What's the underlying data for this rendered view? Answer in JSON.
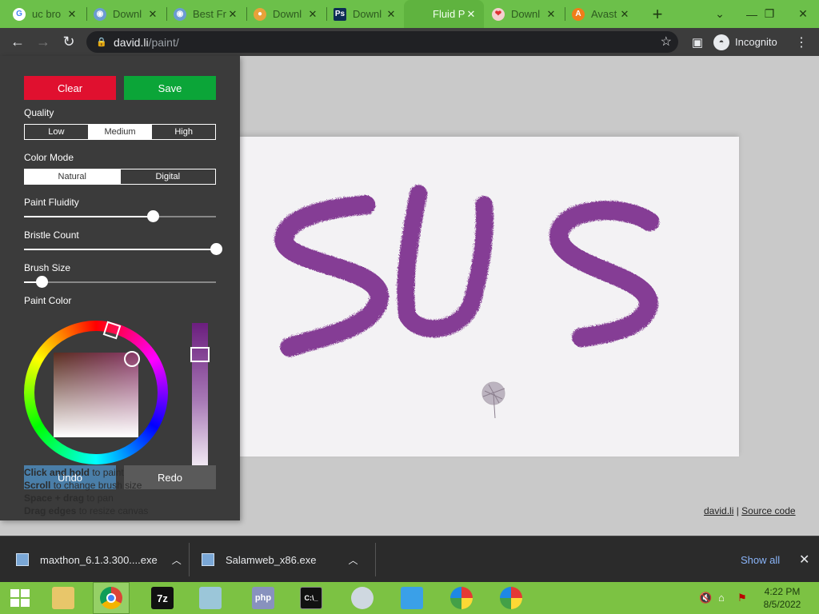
{
  "browser": {
    "tabs": [
      {
        "title": "uc bro",
        "favicon": "google-icon",
        "color": "#ffffff"
      },
      {
        "title": "Downl",
        "favicon": "globe-icon",
        "color": "#6b9bd1"
      },
      {
        "title": "Best Fr",
        "favicon": "globe-icon",
        "color": "#6b9bd1"
      },
      {
        "title": "Downl",
        "favicon": "chrome-icon",
        "color": "#e8a23a"
      },
      {
        "title": "Downl",
        "favicon": "photoshop-icon",
        "color": "#0d2d55"
      },
      {
        "title": "Fluid P",
        "favicon": "none",
        "color": "#5fb33f"
      },
      {
        "title": "Downl",
        "favicon": "paint-icon",
        "color": "#f06a6a"
      },
      {
        "title": "Avast",
        "favicon": "avast-icon",
        "color": "#f07d1a"
      }
    ],
    "new_tab": "+",
    "url_host": "david.li",
    "url_path": "/paint/",
    "incognito_label": "Incognito"
  },
  "panel": {
    "clear_label": "Clear",
    "save_label": "Save",
    "quality_label": "Quality",
    "quality_options": [
      "Low",
      "Medium",
      "High"
    ],
    "quality_selected": "Medium",
    "color_mode_label": "Color Mode",
    "color_mode_options": [
      "Natural",
      "Digital"
    ],
    "color_mode_selected": "Natural",
    "fluidity_label": "Paint Fluidity",
    "fluidity_value": 0.67,
    "bristle_label": "Bristle Count",
    "bristle_value": 1.0,
    "brush_size_label": "Brush Size",
    "brush_size_value": 0.09,
    "paint_color_label": "Paint Color",
    "undo_label": "Undo",
    "redo_label": "Redo",
    "tips": [
      {
        "bold": "Click and hold",
        "rest": " to paint"
      },
      {
        "bold": "Scroll",
        "rest": " to change brush size"
      },
      {
        "bold": "Space + drag",
        "rest": " to pan"
      },
      {
        "bold": "Drag edges",
        "rest": " to resize canvas"
      }
    ],
    "paint_color": "#7b2d8e"
  },
  "canvas": {
    "painted_text": "SUS"
  },
  "credits": {
    "author": "david.li",
    "separator": "|",
    "source": "Source code"
  },
  "downloads": {
    "items": [
      {
        "name": "maxthon_6.1.3.300....exe"
      },
      {
        "name": "Salamweb_x86.exe"
      }
    ],
    "show_all": "Show all"
  },
  "taskbar": {
    "time": "4:22 PM",
    "date": "8/5/2022"
  }
}
